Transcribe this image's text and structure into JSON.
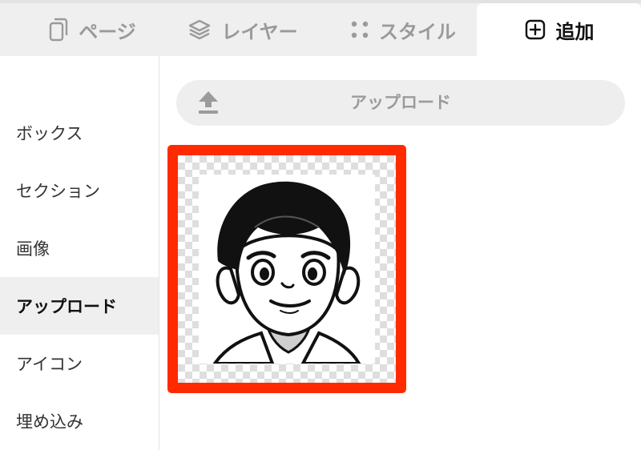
{
  "tabs": [
    {
      "label": "ページ",
      "icon": "page-icon"
    },
    {
      "label": "レイヤー",
      "icon": "layers-icon"
    },
    {
      "label": "スタイル",
      "icon": "dots-icon"
    },
    {
      "label": "追加",
      "icon": "plus-box-icon",
      "active": true
    }
  ],
  "sidebar": {
    "items": [
      {
        "label": "ボックス"
      },
      {
        "label": "セクション"
      },
      {
        "label": "画像"
      },
      {
        "label": "アップロード",
        "active": true
      },
      {
        "label": "アイコン"
      },
      {
        "label": "埋め込み"
      }
    ]
  },
  "upload": {
    "label": "アップロード",
    "icon": "upload-icon"
  },
  "colors": {
    "selection": "#ff2a00",
    "tab_bg": "#efefef",
    "active_text": "#111111",
    "inactive_text": "#9a9a9a"
  }
}
